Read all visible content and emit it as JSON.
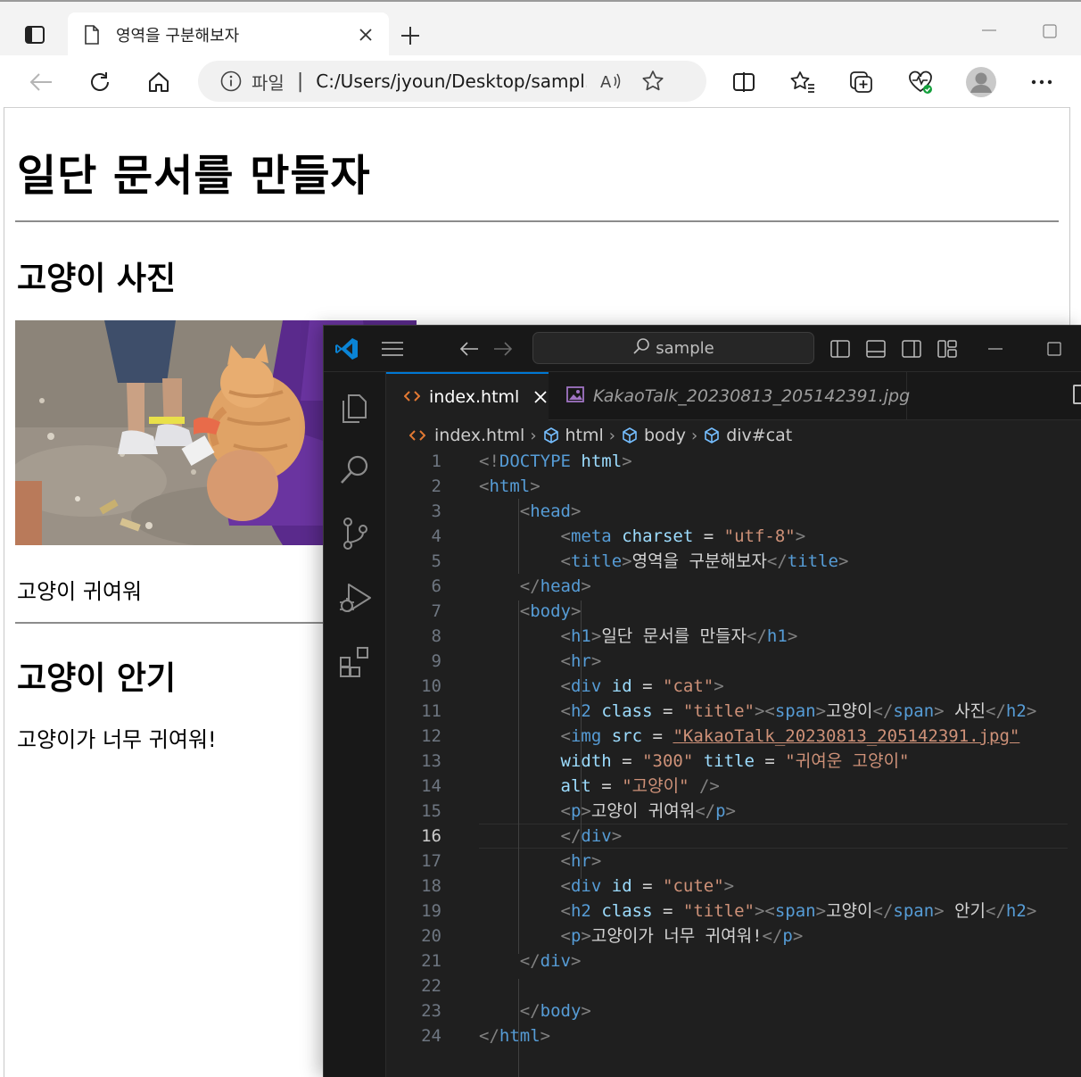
{
  "browser": {
    "tab_title": "영역을 구분해보자",
    "address_scheme_label": "파일",
    "address_separator": "|",
    "address_url": "C:/Users/jyoun/Desktop/sampl...",
    "page": {
      "h1": "일단 문서를 만들자",
      "section1_h2": "고양이 사진",
      "section1_p": "고양이 귀여워",
      "section2_h2": "고양이 안기",
      "section2_p": "고양이가 너무 귀여워!"
    }
  },
  "vscode": {
    "search_text": "sample",
    "tabs": [
      {
        "label": "index.html",
        "active": true
      },
      {
        "label": "KakaoTalk_20230813_205142391.jpg",
        "active": false
      }
    ],
    "breadcrumbs": [
      "index.html",
      "html",
      "body",
      "div#cat"
    ],
    "current_line": 16,
    "lines": [
      {
        "n": "1"
      },
      {
        "n": "2"
      },
      {
        "n": "3"
      },
      {
        "n": "4"
      },
      {
        "n": "5"
      },
      {
        "n": "6"
      },
      {
        "n": "7"
      },
      {
        "n": "8"
      },
      {
        "n": "9"
      },
      {
        "n": "10"
      },
      {
        "n": "11"
      },
      {
        "n": "12"
      },
      {
        "n": "13"
      },
      {
        "n": "14"
      },
      {
        "n": "15"
      },
      {
        "n": "16"
      },
      {
        "n": "17"
      },
      {
        "n": "18"
      },
      {
        "n": "19"
      },
      {
        "n": "20"
      },
      {
        "n": "21"
      },
      {
        "n": "22"
      },
      {
        "n": "23"
      },
      {
        "n": "24"
      }
    ],
    "code": {
      "l1_doctype": "DOCTYPE",
      "l1_html": "html",
      "l2_html": "html",
      "l3_head": "head",
      "l4_meta": "meta",
      "l4_charset": "charset",
      "l4_value": "\"utf-8\"",
      "l5_title": "title",
      "l5_text": "영역을 구분해보자",
      "l6_head": "head",
      "l7_body": "body",
      "l8_h1": "h1",
      "l8_text": "일단 문서를 만들자",
      "l9_hr": "hr",
      "l10_div": "div",
      "l10_id": "id",
      "l10_value": "\"cat\"",
      "l11_h2": "h2",
      "l11_class": "class",
      "l11_value": "\"title\"",
      "l11_span": "span",
      "l11_text1": "고양이",
      "l11_text2": " 사진",
      "l12_img": "img",
      "l12_src": "src",
      "l12_value": "\"KakaoTalk_20230813_205142391.jpg\"",
      "l13_width": "width",
      "l13_wvalue": "\"300\"",
      "l13_title": "title",
      "l13_tvalue": "\"귀여운 고양이\"",
      "l14_alt": "alt",
      "l14_value": "\"고양이\"",
      "l15_p": "p",
      "l15_text": "고양이 귀여워",
      "l16_div": "div",
      "l17_hr": "hr",
      "l18_div": "div",
      "l18_id": "id",
      "l18_value": "\"cute\"",
      "l19_h2": "h2",
      "l19_class": "class",
      "l19_value": "\"title\"",
      "l19_span": "span",
      "l19_text1": "고양이",
      "l19_text2": " 안기",
      "l20_p": "p",
      "l20_text": "고양이가 너무 귀여워!",
      "l21_div": "div",
      "l23_body": "body",
      "l24_html": "html"
    }
  },
  "colors": {
    "vscode_bg": "#1f1f1f",
    "tag": "#569cd6",
    "attribute": "#9cdcfe",
    "string": "#ce9178",
    "text": "#d4d4d4",
    "punct": "#808080",
    "accent": "#0078d4"
  },
  "icons": {
    "browser": [
      "tab-actions-icon",
      "document-icon",
      "close-icon",
      "plus-icon",
      "minimize-icon",
      "maximize-icon",
      "back-arrow-icon",
      "refresh-icon",
      "home-icon",
      "info-icon",
      "read-aloud-icon",
      "star-icon",
      "split-screen-icon",
      "favorites-icon",
      "collections-icon",
      "browser-essentials-icon",
      "profile-icon",
      "more-icon"
    ],
    "vscode": [
      "vscode-logo-icon",
      "hamburger-icon",
      "back-arrow-icon",
      "forward-arrow-icon",
      "search-icon",
      "explorer-icon",
      "source-control-icon",
      "run-debug-icon",
      "extensions-icon",
      "html-file-icon",
      "image-file-icon",
      "cube-icon"
    ]
  }
}
